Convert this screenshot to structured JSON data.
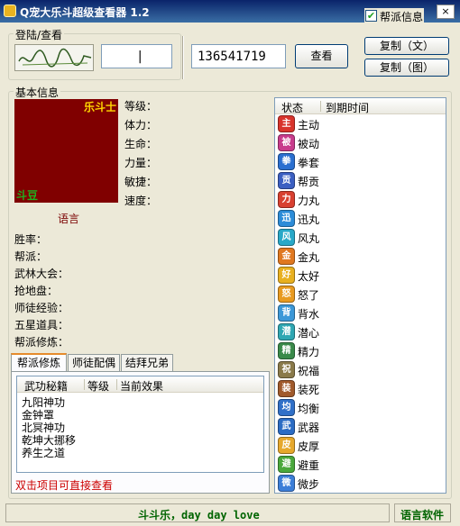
{
  "title": "Q宠大乐斗超级查看器 1.2",
  "header_checkbox": {
    "label": "帮派信息",
    "checked": true
  },
  "close_label": "×",
  "login_group": {
    "title": "登陆/查看",
    "login_value": "|",
    "qq_value": "136541719",
    "view_label": "查看"
  },
  "copy_buttons": {
    "text_label": "复制（文）",
    "image_label": "复制（图）"
  },
  "basic_group": {
    "title": "基本信息"
  },
  "avatar": {
    "top_label": "乐斗士",
    "bottom_label": "斗豆",
    "caption": "语言"
  },
  "stats": [
    "等级：",
    "体力：",
    "生命：",
    "力量：",
    "敏捷：",
    "速度："
  ],
  "info_labels": [
    "胜率：",
    "帮派：",
    "武林大会：",
    "抢地盘：",
    "师徒经验：",
    "五星道具：",
    "帮派修炼："
  ],
  "tabs": [
    {
      "label": "帮派修炼",
      "active": true
    },
    {
      "label": "师徒配偶",
      "active": false
    },
    {
      "label": "结拜兄弟",
      "active": false
    }
  ],
  "skills_table": {
    "columns": [
      "武功秘籍",
      "等级",
      "当前效果"
    ],
    "rows": [
      "九阳神功",
      "金钟罩",
      "北冥神功",
      "乾坤大挪移",
      "养生之道"
    ]
  },
  "hint": "双击项目可直接查看",
  "status_table": {
    "columns": [
      "状态",
      "到期时间"
    ],
    "rows": [
      {
        "icon": "主",
        "label": "主动",
        "color": "#d8342c"
      },
      {
        "icon": "被",
        "label": "被动",
        "color": "#c83c8c"
      },
      {
        "icon": "拳",
        "label": "拳套",
        "color": "#2a6fd0"
      },
      {
        "icon": "贡",
        "label": "帮贡",
        "color": "#3b5fc2"
      },
      {
        "icon": "力",
        "label": "力丸",
        "color": "#d84030"
      },
      {
        "icon": "迅",
        "label": "迅丸",
        "color": "#2c8cd8"
      },
      {
        "icon": "风",
        "label": "风丸",
        "color": "#28a8c8"
      },
      {
        "icon": "金",
        "label": "金丸",
        "color": "#e07820"
      },
      {
        "icon": "好",
        "label": "太好",
        "color": "#e8b020"
      },
      {
        "icon": "怒",
        "label": "怒了",
        "color": "#e89a20"
      },
      {
        "icon": "背",
        "label": "背水",
        "color": "#3c98d8"
      },
      {
        "icon": "潜",
        "label": "潜心",
        "color": "#2fa7b3"
      },
      {
        "icon": "精",
        "label": "精力",
        "color": "#3a8a4a"
      },
      {
        "icon": "祝",
        "label": "祝福",
        "color": "#8a7a4a"
      },
      {
        "icon": "装",
        "label": "装死",
        "color": "#a05a2c"
      },
      {
        "icon": "均",
        "label": "均衡",
        "color": "#3070c8"
      },
      {
        "icon": "武",
        "label": "武器",
        "color": "#2b6cc4"
      },
      {
        "icon": "皮",
        "label": "皮厚",
        "color": "#e6a82c"
      },
      {
        "icon": "避",
        "label": "避重",
        "color": "#4aa83c"
      },
      {
        "icon": "微",
        "label": "微步",
        "color": "#3c7ed8"
      }
    ]
  },
  "statusbar": {
    "left_text": "斗斗乐，day day love",
    "right_text": "语言软件"
  }
}
